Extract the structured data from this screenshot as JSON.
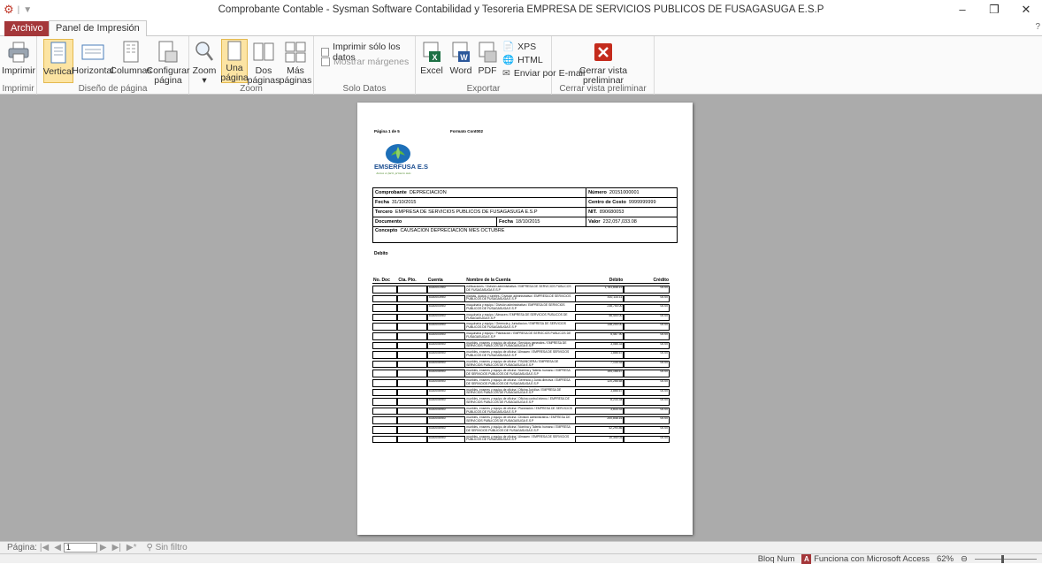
{
  "window": {
    "title": "Comprobante Contable  -  Sysman Software Contabilidad y Tesoreria EMPRESA DE SERVICIOS PUBLICOS DE FUSAGASUGA E.S.P",
    "minimize": "–",
    "maximize": "❐",
    "close": "✕"
  },
  "tabs": {
    "file": "Archivo",
    "print_preview": "Panel de Impresión"
  },
  "ribbon": {
    "print": {
      "print_label": "Imprimir",
      "group": "Imprimir"
    },
    "layout": {
      "portrait": "Vertical",
      "landscape": "Horizontal",
      "columns": "Columnas",
      "page_setup_1": "Configurar",
      "page_setup_2": "página",
      "group": "Diseño de página"
    },
    "zoom": {
      "zoom_label": "Zoom",
      "one_page_1": "Una",
      "one_page_2": "página",
      "two_pages_1": "Dos",
      "two_pages_2": "páginas",
      "more_pages_1": "Más",
      "more_pages_2": "páginas",
      "group": "Zoom"
    },
    "data_only": {
      "print_data_only": "Imprimir sólo los datos",
      "show_margins": "Mostrar márgenes",
      "group": "Solo Datos"
    },
    "export": {
      "excel": "Excel",
      "word": "Word",
      "pdf": "PDF",
      "xps": "XPS",
      "html": "HTML",
      "email": "Enviar por E-mail",
      "group": "Exportar"
    },
    "close": {
      "close_1": "Cerrar vista",
      "close_2": "preliminar",
      "group": "Cerrar vista preliminar"
    }
  },
  "report": {
    "page_label": "Página 1 de 5",
    "format_label": "Formato Cont002",
    "logo_text": "EMSERFUSA E.S.P",
    "logo_slogan": "Juntos es fácil, primero más",
    "comprobante_lbl": "Comprobante",
    "comprobante_val": "DEPRECIACION",
    "numero_lbl": "Número",
    "numero_val": "20151000001",
    "fecha_lbl": "Fecha",
    "fecha_val": "31/10/2015",
    "centro_lbl": "Centro de Costo",
    "centro_val": "9999999999",
    "tercero_lbl": "Tercero",
    "tercero_val": "EMPRESA DE SERVICIOS PUBLICOS DE FUSAGASUGA E.S.P",
    "nit_lbl": "NIT.",
    "nit_val": "890680053",
    "documento_lbl": "Documento",
    "fecha2_lbl": "Fecha",
    "fecha2_val": "18/10/2015",
    "valor_lbl": "Valor",
    "valor_val": "232,057,033.08",
    "concepto_lbl": "Concepto",
    "concepto_val": "CAUSACION DEPRECIACION MES OCTUBRE",
    "debito_lbl": "Debito",
    "headers": {
      "doc": "No. Doc",
      "cta": "Cta. Pto.",
      "cuenta": "Cuenta",
      "nombre": "Nombre de la Cuenta",
      "debito": "Débito",
      "credito": "Crédito"
    },
    "rows": [
      {
        "cuenta": "5330001950",
        "nombre": "edificaciones / División administrativa / EMPRESA DE SERVICIOS PUBLICOS DE FUSAGASUGA E.S.P",
        "debito": "1,781,848.19",
        "credito": "00.00"
      },
      {
        "cuenta": "5330003950",
        "nombre": "plantas, ductos y túneles / División administrativa / EMPRESA DE SERVICIOS PUBLICOS DE FUSAGASUGA E.S.P",
        "debito": "410,133.11",
        "credito": "00.00"
      },
      {
        "cuenta": "5330004950",
        "nombre": "maquinaria y equipo / División administrativa / EMPRESA DE SERVICIOS PUBLICOS DE FUSAGASUGA E.S.P",
        "debito": "238,750.00",
        "credito": "00.00"
      },
      {
        "cuenta": "5330004950",
        "nombre": "maquinaria y equipo / Almacen / EMPRESA DE SERVICIOS PUBLICOS DE FUSAGASUGA E.S.P",
        "debito": "46,400.00",
        "credito": "00.00"
      },
      {
        "cuenta": "5330004950",
        "nombre": "maquinaria y equipo / Gerencia y Jurisdiccion / EMPRESA DE SERVICIOS PUBLICOS DE FUSAGASUGA E.S.P",
        "debito": "138,200.00",
        "credito": "00.00"
      },
      {
        "cuenta": "5330004950",
        "nombre": "maquinaria y equipo / Planeación / EMPRESA DE SERVICIOS PUBLICOS DE FUSAGASUGA E.S.P",
        "debito": "5,467.90",
        "credito": "00.00"
      },
      {
        "cuenta": "5330006950",
        "nombre": "muebles, enseres y equipo de oficina / Servicios generales / EMPRESA DE SERVICIOS PUBLICOS DE FUSAGASUGA E.S.P",
        "debito": "3,085.33",
        "credito": "00.00"
      },
      {
        "cuenta": "5330006950",
        "nombre": "muebles, enseres y equipo de oficina / Almacen / EMPRESA DE SERVICIOS PUBLICOS DE FUSAGASUGA E.S.P",
        "debito": "1,886.67",
        "credito": "00.00"
      },
      {
        "cuenta": "5330006950",
        "nombre": "muebles, enseres y equipo de oficina / FINANCIERA / EMPRESA DE SERVICIOS PUBLICOS DE FUSAGASUGA E.S.P",
        "debito": "7,133.33",
        "credito": "00.00"
      },
      {
        "cuenta": "5330006950",
        "nombre": "muebles, enseres y equipo de oficina / Nomina y Talento humano / EMPRESA DE SERVICIOS PUBLICOS DE FUSAGASUGA E.S.P",
        "debito": "154,166.67",
        "credito": "00.00"
      },
      {
        "cuenta": "5330006950",
        "nombre": "muebles, enseres y equipo de oficina / Gerencia y Junta directiva / EMPRESA DE SERVICIOS PUBLICOS DE FUSAGASUGA E.S.P",
        "debito": "120,266.68",
        "credito": "00.00"
      },
      {
        "cuenta": "5330006950",
        "nombre": "muebles, enseres y equipo de oficina / Oficina Jurídica / EMPRESA DE SERVICIOS PUBLICOS DE FUSAGASUGA E.S.P",
        "debito": "3,866.67",
        "credito": "00.00"
      },
      {
        "cuenta": "5330006950",
        "nombre": "muebles, enseres y equipo de oficina / Oficina control interno / EMPRESA DE SERVICIOS PUBLICOS DE FUSAGASUGA E.S.P",
        "debito": "8,233.34",
        "credito": "00.00"
      },
      {
        "cuenta": "5330006950",
        "nombre": "muebles, enseres y equipo de oficina / Planeación / EMPRESA DE SERVICIOS PUBLICOS DE FUSAGASUGA E.S.P",
        "debito": "3,833.33",
        "credito": "00.00"
      },
      {
        "cuenta": "5330006950",
        "nombre": "muebles, enseres y equipo de oficina / División administrativa / EMPRESA DE SERVICIOS PUBLICOS DE FUSAGASUGA E.S.P",
        "debito": "200,848.16",
        "credito": "00.00"
      },
      {
        "cuenta": "5330006950",
        "nombre": "muebles, enseres y equipo de oficina / Nomina y Talento humano / EMPRESA DE SERVICIOS PUBLICOS DE FUSAGASUGA E.S.P",
        "debito": "42,290.86",
        "credito": "00.00"
      },
      {
        "cuenta": "5330006950",
        "nombre": "muebles, enseres y equipo de oficina / Almacen / EMPRESA DE SERVICIOS PUBLICOS DE FUSAGASUGA E.S.P",
        "debito": "10,340.03",
        "credito": "00.00"
      }
    ]
  },
  "navigation": {
    "page_label": "Página:",
    "current_page": "1",
    "filter": "Sin filtro"
  },
  "status": {
    "num_lock": "Bloq Num",
    "access_text": "Funciona con Microsoft Access",
    "zoom_level": "62%"
  },
  "colors": {
    "file_tab": "#a4373a",
    "active_button": "#fce4a3",
    "workspace": "#ababab"
  }
}
